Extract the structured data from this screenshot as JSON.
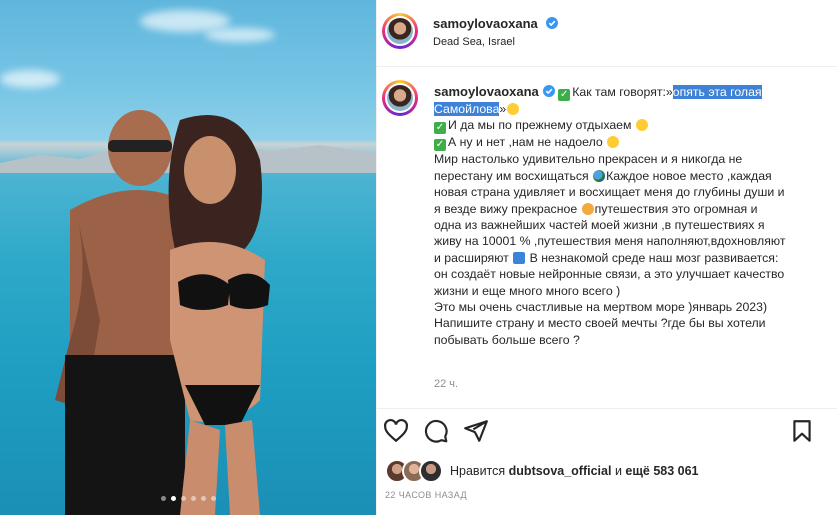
{
  "post": {
    "username": "samoylovaoxana",
    "location": "Dead Sea, Israel",
    "caption": {
      "line1_pre": "Как там говорят:»",
      "line1_highlight": "опять эта голая",
      "line2_highlight": "Самойлова",
      "line2_post": "»",
      "line3": "И да мы по прежнему отдыхаем",
      "line4": "А ну и нет ,нам не надоело",
      "line5": "Мир настолько удивительно прекрасен и я никогда не",
      "line6_pre": "перестану им восхищаться",
      "line6_post": "Каждое новое место ,каждая",
      "line7": "новая страна удивляет и восхищает меня до глубины души и",
      "line8_pre": "я везде вижу прекрасное",
      "line8_post": "путешествия это огромная и",
      "line9": "одна из важнейших частей моей жизни ,в путешествиях я",
      "line10": "живу на 10001 % ,путешествия меня наполняют,вдохновляют",
      "line11_pre": "и расширяют",
      "line11_post": "В незнакомой среде наш мозг развивается:",
      "line12": "он создаёт новые нейронные связи, а это улучшает качество",
      "line13": "жизни и еще много много всего )",
      "line14": "Это мы очень счастливые на мертвом море )январь 2023)",
      "line15": "Напишите страну и место своей мечты ?где бы вы хотели",
      "line16": "побывать больше всего ?"
    },
    "time_ago": "22 ч.",
    "likes": {
      "prefix": "Нравится",
      "user": "dubtsova_official",
      "connector": "и",
      "count": "ещё 583 061"
    },
    "date": "22 ЧАСОВ НАЗАД"
  },
  "icons": {
    "like": "heart-icon",
    "comment": "comment-icon",
    "share": "send-icon",
    "save": "bookmark-icon",
    "more": "more-icon",
    "verified": "verified-badge-icon"
  },
  "colors": {
    "highlight": "#3d82d8",
    "verified": "#3897f0",
    "muted": "#8e8e8e"
  },
  "carousel": {
    "total": 6,
    "active": 2
  }
}
